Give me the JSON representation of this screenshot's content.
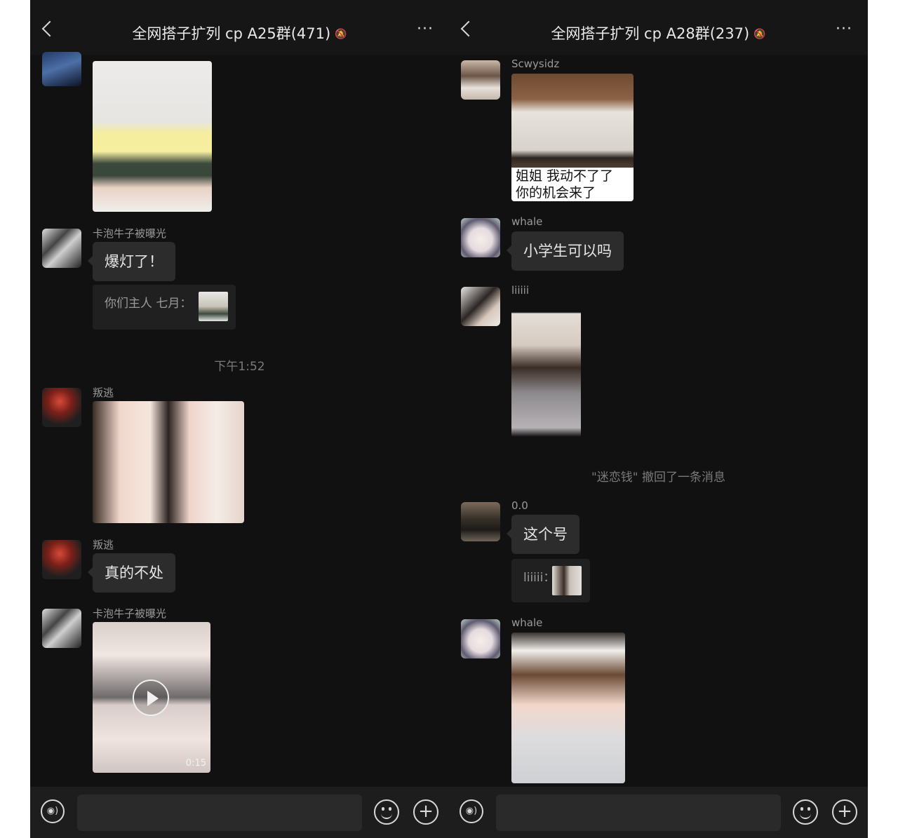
{
  "left": {
    "title": "全网搭子扩列 cp A25群(471)",
    "more_label": "···",
    "timestamp": "下午1:52",
    "messages": {
      "m2_sender": "卡泡牛子被曝光",
      "m2_text": "爆灯了！",
      "m2_quote": "你们主人 七月：",
      "m3_sender": "叛逃",
      "m4_sender": "叛逃",
      "m4_text": "真的不处",
      "m5_sender": "卡泡牛子被曝光",
      "m5_duration": "0:15"
    }
  },
  "right": {
    "title": "全网搭子扩列 cp A28群(237)",
    "more_label": "···",
    "system_notice": "\"迷恋钱\" 撤回了一条消息",
    "messages": {
      "m1_sender": "Scwysidz",
      "m1_caption_line1": "姐姐  我动不了了",
      "m1_caption_line2": "你的机会来了",
      "m2_sender": "whale",
      "m2_text": "小学生可以吗",
      "m3_sender": "liiiii",
      "m4_sender": "0.0",
      "m4_text": "这个号",
      "m4_quote": "liiiii：",
      "m5_sender": "whale"
    }
  },
  "icons": {
    "back": "chevron-left-icon",
    "mute": "bell-slash-icon",
    "voice": "voice-icon",
    "emoji": "emoji-icon",
    "plus": "plus-icon",
    "play": "play-icon"
  },
  "colors": {
    "background": "#111111",
    "bubble": "#2c2c2c",
    "text": "#e6e6e6",
    "muted_text": "#9a9a9a"
  }
}
